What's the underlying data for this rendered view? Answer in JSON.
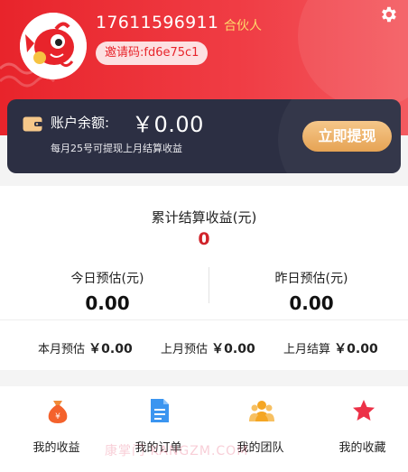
{
  "profile": {
    "phone": "17611596911",
    "role": "合伙人",
    "invite_code": "邀请码:fd6e75c1"
  },
  "icons": {
    "settings": "gear-icon",
    "wallet": "wallet-icon",
    "avatar": "fish-mascot-avatar"
  },
  "balance": {
    "label": "账户余额:",
    "amount": "￥0.00",
    "note": "每月25号可提现上月结算收益",
    "withdraw_label": "立即提现"
  },
  "earnings": {
    "total_label": "累计结算收益(元)",
    "total_value": "0",
    "today_label": "今日预估(元)",
    "today_value": "0.00",
    "yesterday_label": "昨日预估(元)",
    "yesterday_value": "0.00",
    "this_month_label": "本月预估",
    "this_month_value": "￥0.00",
    "last_month_est_label": "上月预估",
    "last_month_est_value": "￥0.00",
    "last_month_settled_label": "上月结算",
    "last_month_settled_value": "￥0.00"
  },
  "menu": [
    {
      "label": "我的收益",
      "icon": "money-bag-icon"
    },
    {
      "label": "我的订单",
      "icon": "document-icon"
    },
    {
      "label": "我的团队",
      "icon": "team-icon"
    },
    {
      "label": "我的收藏",
      "icon": "star-icon"
    }
  ],
  "watermark": "康掌门 KANGZM.COM",
  "colors": {
    "header_red": "#e8242b",
    "card_dark": "#2c2f43",
    "withdraw_gold": "#e6a354",
    "accent_red": "#d0232a"
  }
}
